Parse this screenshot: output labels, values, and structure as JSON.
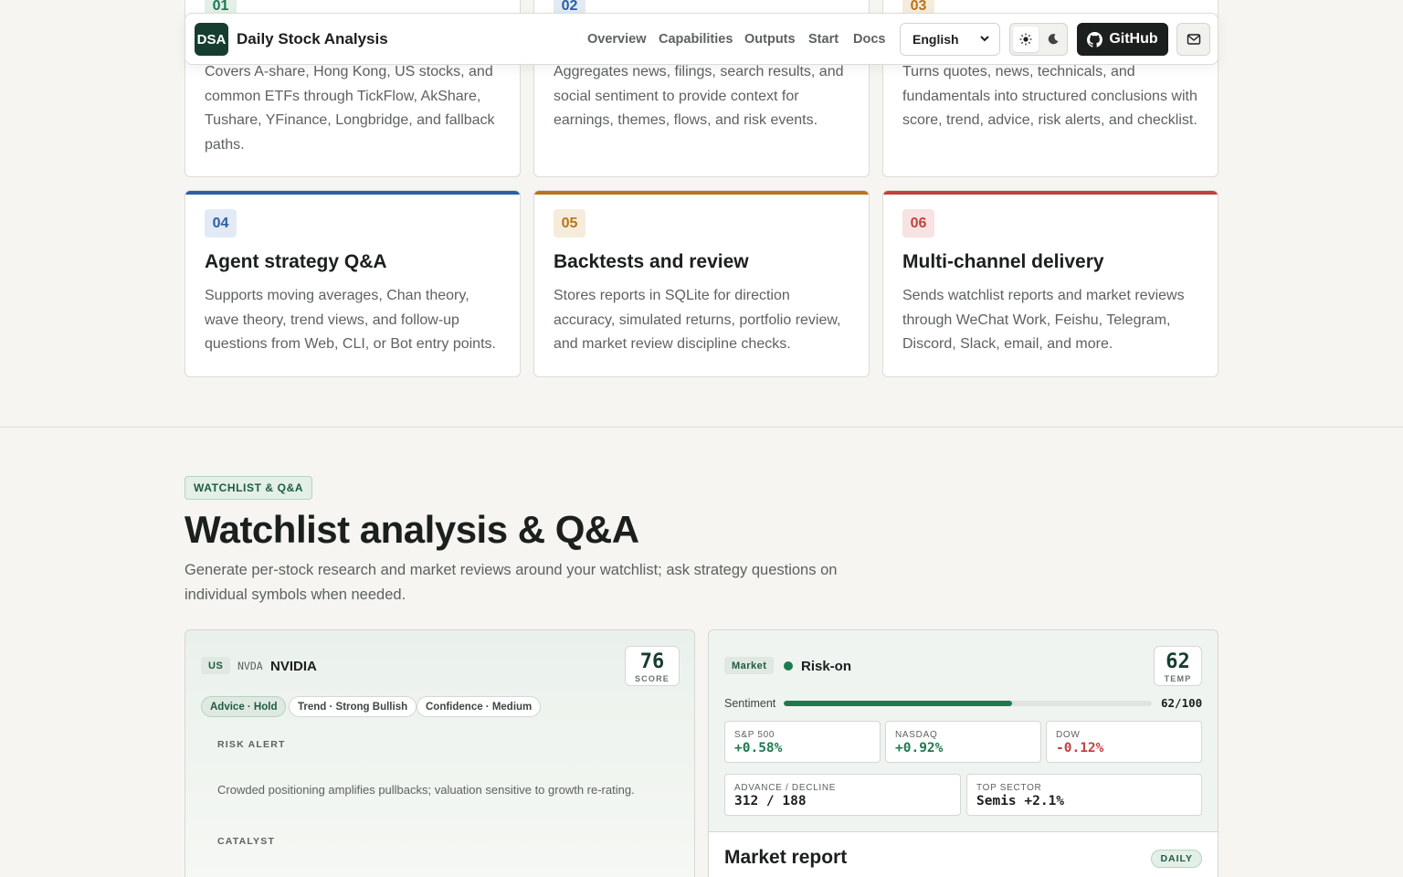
{
  "header": {
    "logo": "DSA",
    "brand": "Daily Stock Analysis",
    "nav": [
      "Overview",
      "Capabilities",
      "Outputs",
      "Start",
      "Docs"
    ],
    "language": "English",
    "github_label": "GitHub"
  },
  "features": [
    {
      "num": "01",
      "desc": "Covers A-share, Hong Kong, US stocks, and common ETFs through TickFlow, AkShare, Tushare, YFinance, Longbridge, and fallback paths.",
      "color": "#1e7a4e",
      "tint": "#e3efe7"
    },
    {
      "num": "02",
      "desc": "Aggregates news, filings, search results, and social sentiment to provide context for earnings, themes, flows, and risk events.",
      "color": "#2a5fa8",
      "tint": "#e2eaf5"
    },
    {
      "num": "03",
      "desc": "Turns quotes, news, technicals, and fundamentals into structured conclusions with score, trend, advice, risk alerts, and checklist.",
      "color": "#b8741a",
      "tint": "#f6ecdc"
    },
    {
      "num": "04",
      "title": "Agent strategy Q&A",
      "desc": "Supports moving averages, Chan theory, wave theory, trend views, and follow-up questions from Web, CLI, or Bot entry points.",
      "color": "#2a5fa8",
      "tint": "#e2eaf5"
    },
    {
      "num": "05",
      "title": "Backtests and review",
      "desc": "Stores reports in SQLite for direction accuracy, simulated returns, portfolio review, and market review discipline checks.",
      "color": "#b8741a",
      "tint": "#f6ecdc"
    },
    {
      "num": "06",
      "title": "Multi-channel delivery",
      "desc": "Sends watchlist reports and market reviews through WeChat Work, Feishu, Telegram, Discord, Slack, email, and more.",
      "color": "#c0423f",
      "tint": "#f7e3e2"
    }
  ],
  "section": {
    "eyebrow": "WATCHLIST & Q&A",
    "title": "Watchlist analysis & Q&A",
    "desc": "Generate per-stock research and market reviews around your watchlist; ask strategy questions on individual symbols when needed."
  },
  "stock": {
    "market": "US",
    "ticker": "NVDA",
    "name": "NVIDIA",
    "score": "76",
    "score_label": "SCORE",
    "chips": [
      "Advice · Hold",
      "Trend · Strong Bullish",
      "Confidence · Medium"
    ],
    "risk_label": "RISK ALERT",
    "risk_text": "Crowded positioning amplifies pullbacks; valuation sensitive to growth re-rating.",
    "catalyst_label": "CATALYST"
  },
  "market": {
    "tag": "Market",
    "state": "Risk-on",
    "temp": "62",
    "temp_label": "TEMP",
    "sentiment_label": "Sentiment",
    "sentiment_value": "62/100",
    "sentiment_fraction": 0.62,
    "indices": [
      {
        "name": "S&P 500",
        "value": "+0.58%",
        "color": "#1e7a4e"
      },
      {
        "name": "NASDAQ",
        "value": "+0.92%",
        "color": "#1e7a4e"
      },
      {
        "name": "DOW",
        "value": "-0.12%",
        "color": "#c0423f"
      }
    ],
    "breadth_label": "ADVANCE / DECLINE",
    "breadth_value": "312 / 188",
    "sector_label": "TOP SECTOR",
    "sector_value": "Semis +2.1%",
    "report_title": "Market report",
    "report_badge": "DAILY"
  }
}
